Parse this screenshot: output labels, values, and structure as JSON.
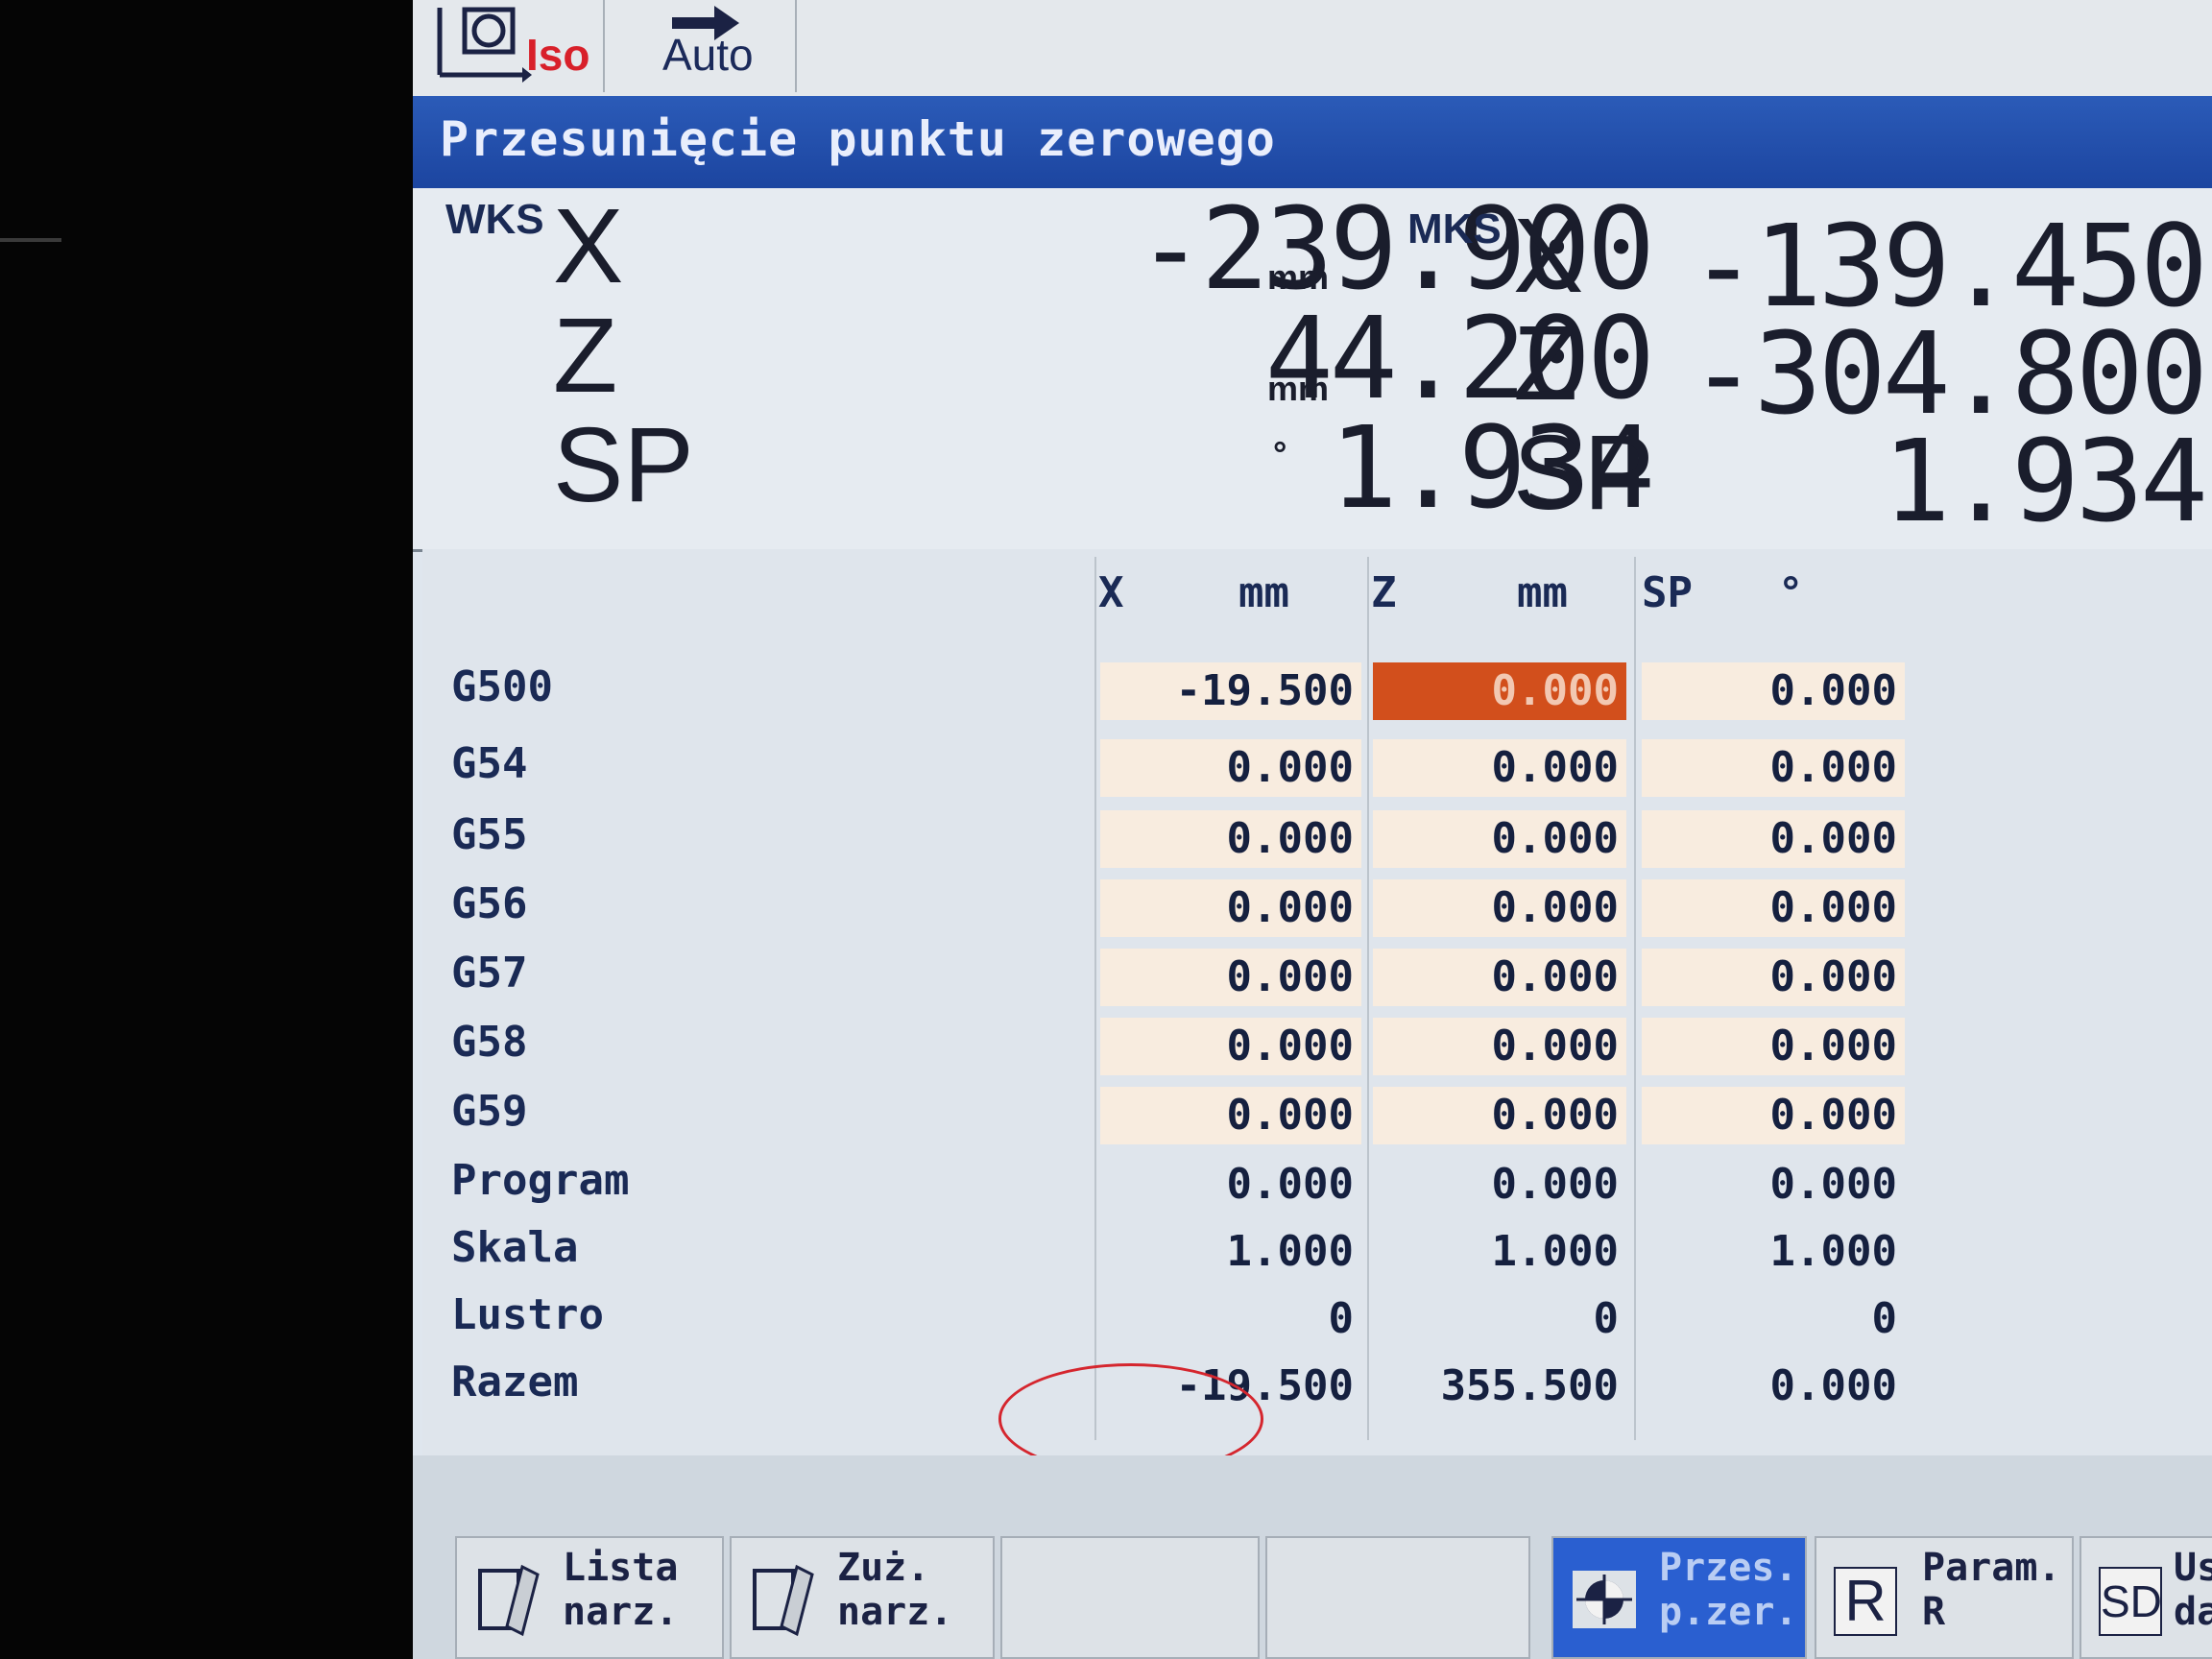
{
  "toolbar": {
    "iso": "Iso",
    "auto": "Auto"
  },
  "title": "Przesunięcie punktu zerowego",
  "wks": {
    "tag": "WKS",
    "rows": [
      {
        "axis": "X",
        "value": "-239.900",
        "unit": "mm"
      },
      {
        "axis": "Z",
        "value": "44.200",
        "unit": "mm"
      },
      {
        "axis": "SP",
        "value": "1.934",
        "unit": "°"
      }
    ]
  },
  "mks": {
    "tag": "MKS",
    "rows": [
      {
        "axis": "X",
        "value": "-139.450"
      },
      {
        "axis": "Z",
        "value": "-304.800"
      },
      {
        "axis": "SP",
        "value": "1.934"
      }
    ]
  },
  "table": {
    "headers": [
      "X",
      "mm",
      "Z",
      "mm",
      "SP",
      "°"
    ],
    "rows": [
      {
        "label": "G500",
        "x": "-19.500",
        "z": "0.000",
        "sp": "0.000"
      },
      {
        "label": "G54",
        "x": "0.000",
        "z": "0.000",
        "sp": "0.000"
      },
      {
        "label": "G55",
        "x": "0.000",
        "z": "0.000",
        "sp": "0.000"
      },
      {
        "label": "G56",
        "x": "0.000",
        "z": "0.000",
        "sp": "0.000"
      },
      {
        "label": "G57",
        "x": "0.000",
        "z": "0.000",
        "sp": "0.000"
      },
      {
        "label": "G58",
        "x": "0.000",
        "z": "0.000",
        "sp": "0.000"
      },
      {
        "label": "G59",
        "x": "0.000",
        "z": "0.000",
        "sp": "0.000"
      },
      {
        "label": "Program",
        "x": "0.000",
        "z": "0.000",
        "sp": "0.000"
      },
      {
        "label": "Skala",
        "x": "1.000",
        "z": "1.000",
        "sp": "1.000"
      },
      {
        "label": "Lustro",
        "x": "0",
        "z": "0",
        "sp": "0"
      },
      {
        "label": "Razem",
        "x": "-19.500",
        "z": "355.500",
        "sp": "0.000"
      }
    ]
  },
  "softkeys": [
    {
      "text": "Lista\nnarz."
    },
    {
      "text": "Zuż.\nnarz."
    },
    {
      "text": ""
    },
    {
      "text": ""
    },
    {
      "text": "Przes.\np.zer."
    },
    {
      "letter": "R",
      "text": "Param.\nR"
    },
    {
      "letter": "SD",
      "text": "Us\nda"
    }
  ],
  "colors": {
    "title_bar": "#1c45a0",
    "selected_cell": "#d24f1c",
    "annotation_circle": "#d5262e",
    "cell_bg": "#f8ecdf"
  }
}
